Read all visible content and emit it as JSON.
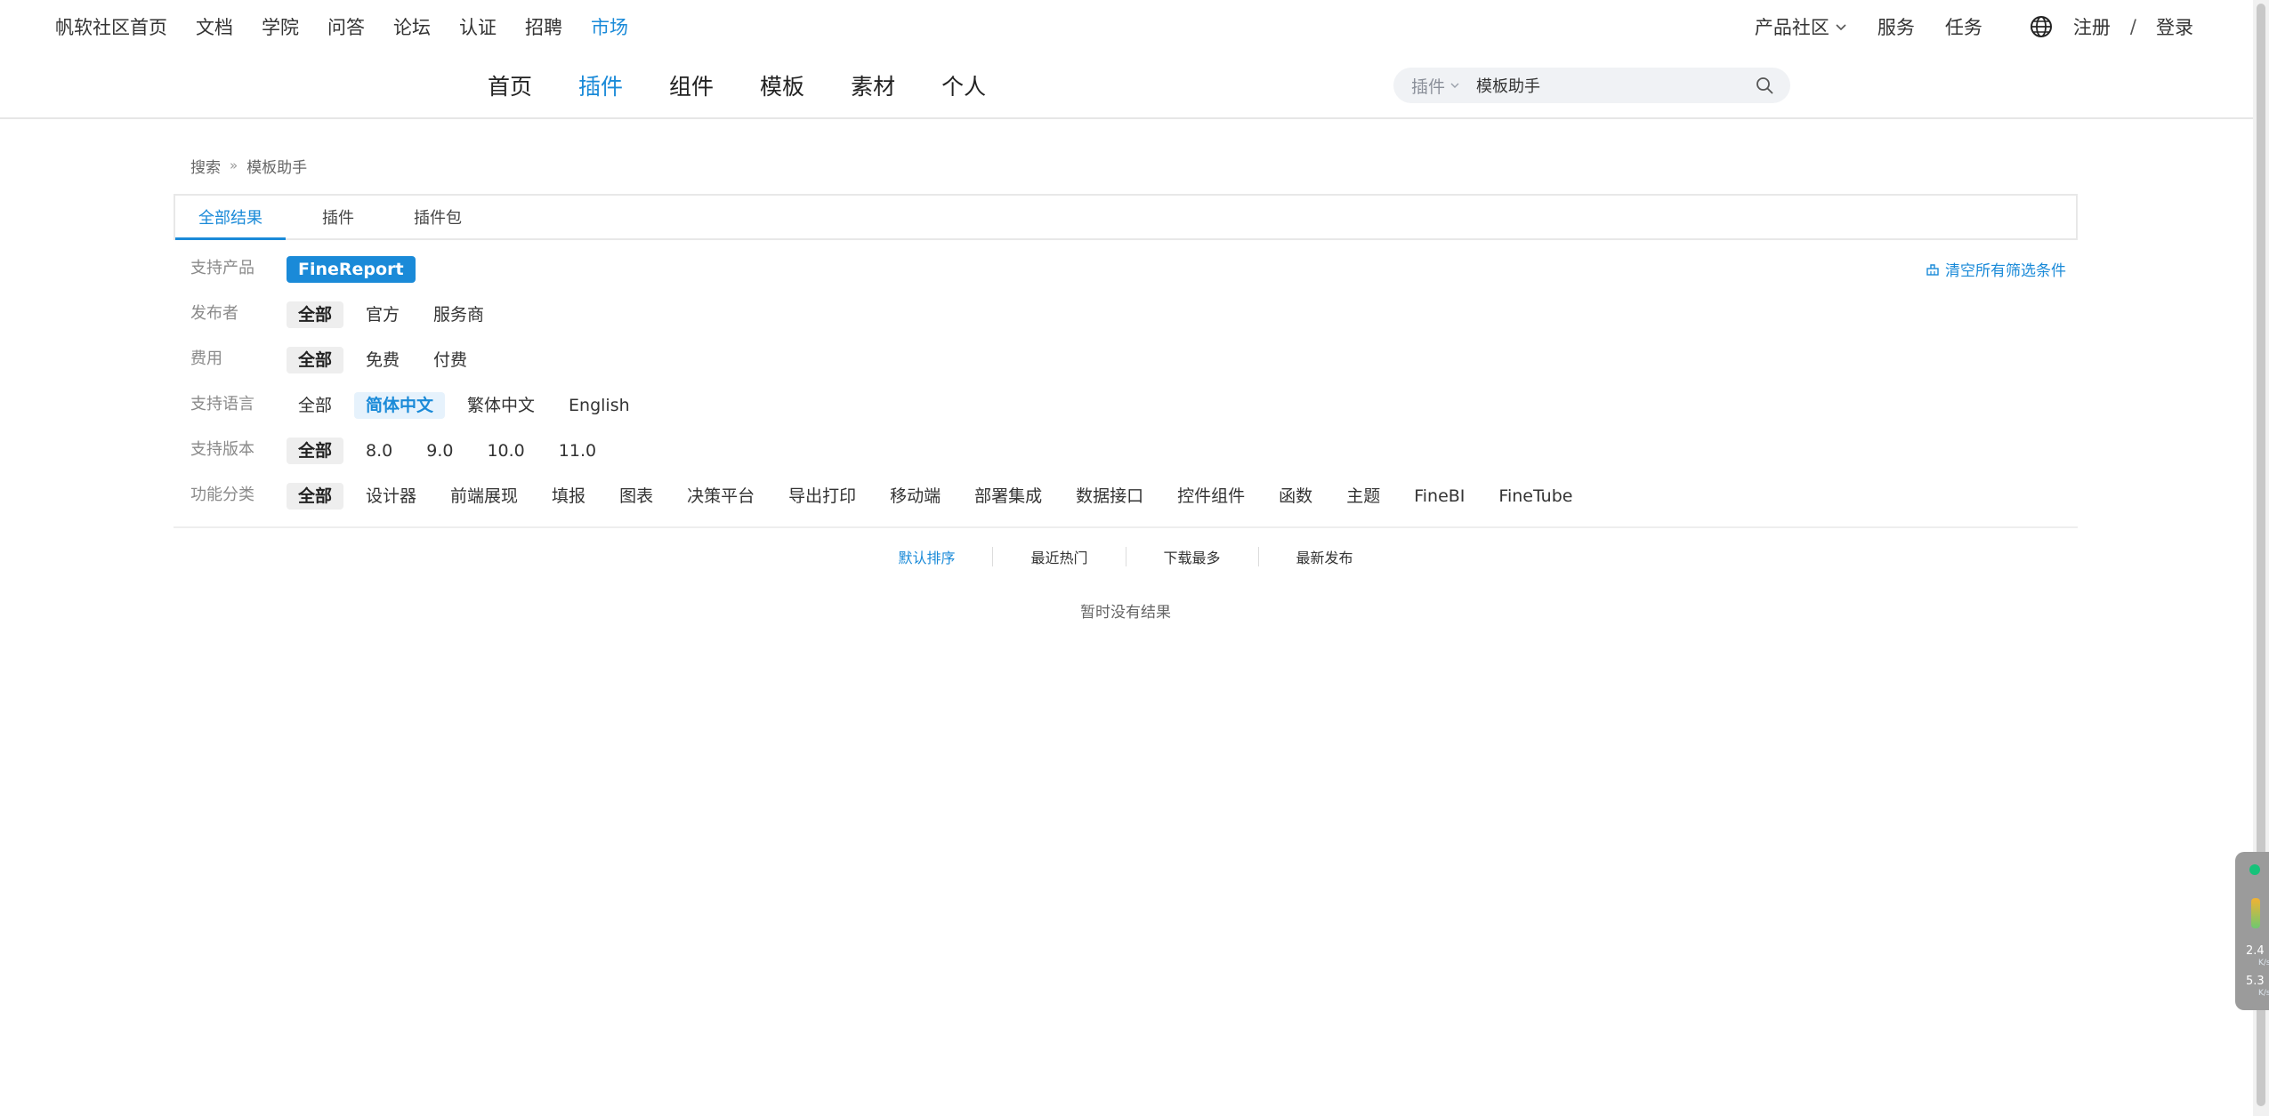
{
  "top_nav": {
    "left_items": [
      "帆软社区首页",
      "文档",
      "学院",
      "问答",
      "论坛",
      "认证",
      "招聘",
      "市场"
    ],
    "active_left": "市场",
    "right_items": [
      "产品社区",
      "服务",
      "任务"
    ],
    "register": "注册",
    "login": "登录",
    "auth_separator": "/"
  },
  "main_nav": {
    "items": [
      "首页",
      "插件",
      "组件",
      "模板",
      "素材",
      "个人"
    ],
    "active": "插件"
  },
  "search": {
    "type": "插件",
    "value": "模板助手"
  },
  "breadcrumb": {
    "root": "搜索",
    "separator": "»",
    "current": "模板助手"
  },
  "tabs": {
    "items": [
      "全部结果",
      "插件",
      "插件包"
    ],
    "active": "全部结果"
  },
  "filters": {
    "clear_label": "清空所有筛选条件",
    "rows": [
      {
        "label": "支持产品",
        "options": [
          "FineReport"
        ],
        "selected": "FineReport"
      },
      {
        "label": "发布者",
        "options": [
          "全部",
          "官方",
          "服务商"
        ],
        "selected": "全部"
      },
      {
        "label": "费用",
        "options": [
          "全部",
          "免费",
          "付费"
        ],
        "selected": "全部"
      },
      {
        "label": "支持语言",
        "options": [
          "全部",
          "简体中文",
          "繁体中文",
          "English"
        ],
        "selected": "简体中文"
      },
      {
        "label": "支持版本",
        "options": [
          "全部",
          "8.0",
          "9.0",
          "10.0",
          "11.0"
        ],
        "selected": "全部"
      },
      {
        "label": "功能分类",
        "options": [
          "全部",
          "设计器",
          "前端展现",
          "填报",
          "图表",
          "决策平台",
          "导出打印",
          "移动端",
          "部署集成",
          "数据接口",
          "控件组件",
          "函数",
          "主题",
          "FineBI",
          "FineTube"
        ],
        "selected": "全部"
      }
    ]
  },
  "sort": {
    "items": [
      "默认排序",
      "最近热门",
      "下载最多",
      "最新发布"
    ],
    "active": "默认排序"
  },
  "empty_message": "暂时没有结果",
  "widget": {
    "upload_value": "2.4",
    "download_value": "5.3",
    "unit_small": "K/s"
  },
  "colors": {
    "accent": "#1a8ad8",
    "selected_gray": "#eeeeee",
    "selected_lightblue": "#e6f2fc"
  }
}
